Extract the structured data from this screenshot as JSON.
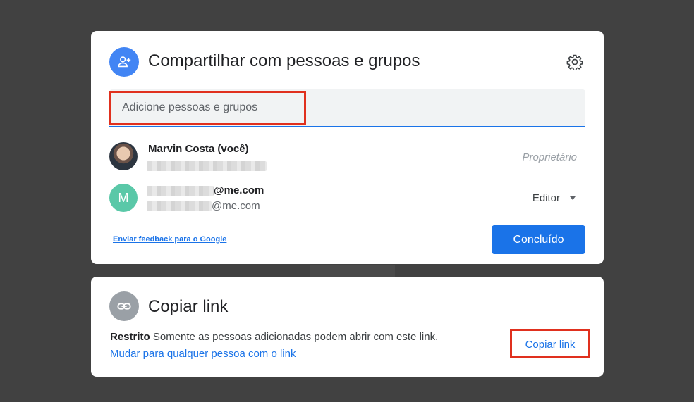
{
  "share_dialog": {
    "title": "Compartilhar com pessoas e grupos",
    "header_icon": "person-add-icon",
    "settings_icon": "gear-icon",
    "search": {
      "placeholder": "Adicione pessoas e grupos"
    },
    "people": [
      {
        "name": "Marvin Costa (você)",
        "email_suffix": "",
        "role": "Proprietário",
        "avatar": "photo"
      },
      {
        "name_suffix": "@me.com",
        "email_suffix": "@me.com",
        "role": "Editor",
        "avatar_letter": "M",
        "avatar_color": "#5ac8a8"
      }
    ],
    "feedback_link": "Enviar feedback para o Google",
    "done_button": "Concluído"
  },
  "link_dialog": {
    "title": "Copiar link",
    "header_icon": "link-icon",
    "restriction_label": "Restrito",
    "restriction_text": "Somente as pessoas adicionadas podem abrir com este link.",
    "change_link": "Mudar para qualquer pessoa com o link",
    "copy_button": "Copiar link"
  },
  "colors": {
    "accent": "#1a73e8",
    "highlight": "#e0301e",
    "background": "#414141"
  }
}
